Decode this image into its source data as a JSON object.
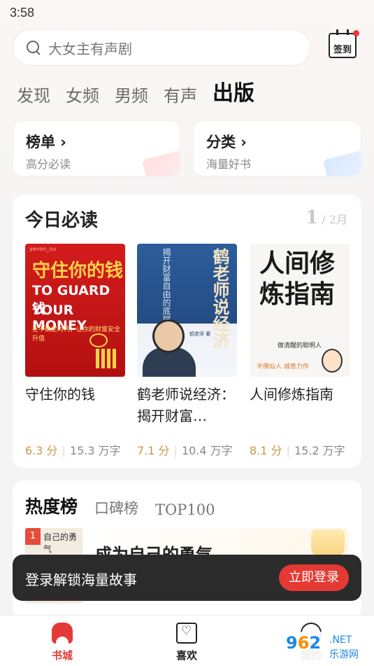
{
  "status_bar": {
    "time": "3:58"
  },
  "search": {
    "placeholder": "大女主有声剧"
  },
  "checkin": {
    "label": "签到"
  },
  "channel_tabs": [
    {
      "label": "发现"
    },
    {
      "label": "女频"
    },
    {
      "label": "男频"
    },
    {
      "label": "有声"
    },
    {
      "label": "出版",
      "active": true
    }
  ],
  "quick_entries": [
    {
      "title": "榜单 ›",
      "subtitle": "高分必读"
    },
    {
      "title": "分类 ›",
      "subtitle": "海量好书"
    }
  ],
  "today_section": {
    "title": "今日必读",
    "page_current": "1",
    "page_total": "/ 2月",
    "books": [
      {
        "title": "守住你的钱",
        "score": "6.3 分",
        "words": "15.3 万字",
        "cover": {
          "top": "yevon_ou",
          "line1": "守住你的钱",
          "line2": "TO GUARD 钱",
          "line3": "YOUR MONEY",
          "line4": "在不确定时代，让你的财富安全升值"
        }
      },
      {
        "title": "鹤老师说经济：揭开财富…",
        "score": "7.1 分",
        "words": "10.4 万字",
        "cover": {
          "line1": "鹤老师说经济",
          "line2": "揭开财富自由的底层逻辑",
          "author": "鹤老师 著"
        }
      },
      {
        "title": "人间修炼指南",
        "score": "8.1 分",
        "words": "15.2 万字",
        "cover": {
          "line1": "人间修炼指南",
          "line2": "做清醒的聪明人",
          "line3": "半佛仙人 诚意力作"
        }
      }
    ]
  },
  "hot_section": {
    "tabs": [
      {
        "label": "热度榜",
        "active": true
      },
      {
        "label": "口碑榜"
      },
      {
        "label": "TOP100"
      }
    ],
    "first_item": {
      "rank": "1",
      "cover_text": "自己的勇气",
      "title": "成为自己的勇气"
    }
  },
  "toast": {
    "message": "登录解锁海量故事",
    "button": "立即登录"
  },
  "bottom_nav": [
    {
      "label": "书城",
      "icon": "bookstore-icon",
      "active": true
    },
    {
      "label": "喜欢",
      "icon": "bookmark-heart-icon"
    },
    {
      "label": "我的",
      "icon": "profile-icon"
    }
  ],
  "watermark": {
    "brand_a": "9",
    "brand_b": "6",
    "brand_c": "2",
    "net": ".NET",
    "site": "乐游网"
  },
  "colors": {
    "accent": "#e53935",
    "score": "#c79a4a",
    "toast_bg": "#2b2b2b"
  }
}
